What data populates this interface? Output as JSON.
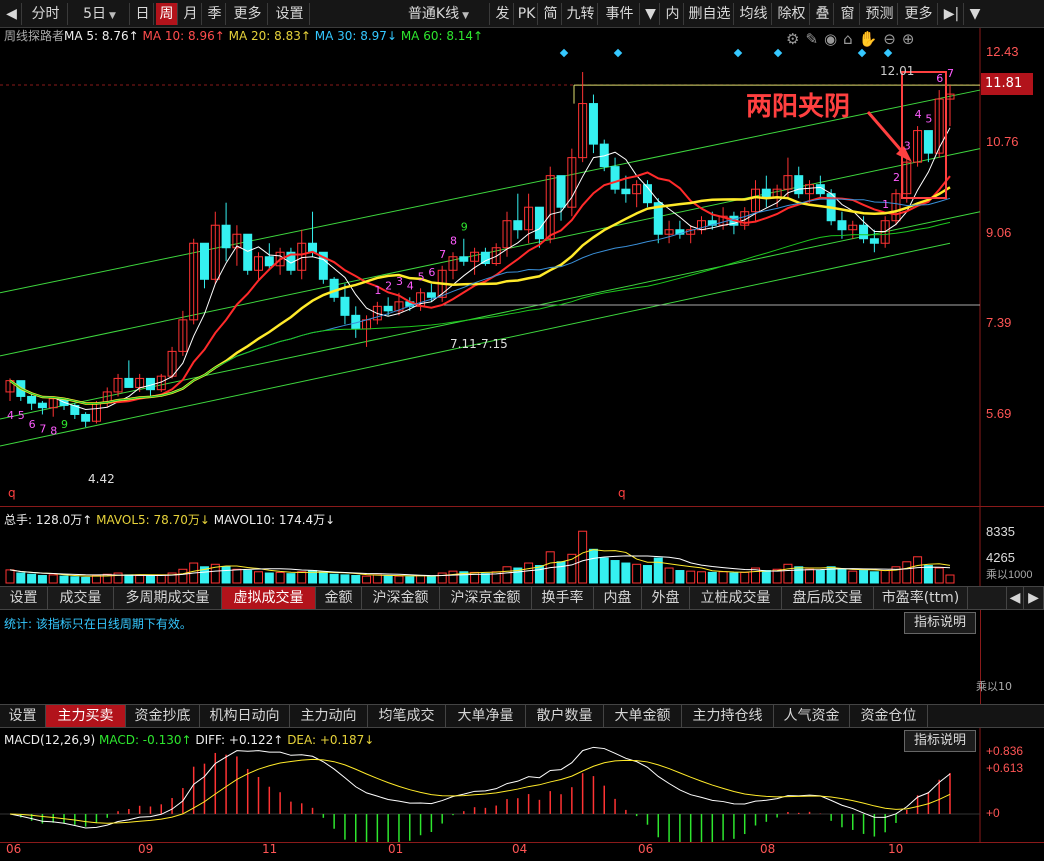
{
  "toolbar": {
    "items": [
      "分时",
      "5日",
      "日",
      "周",
      "月",
      "季",
      "更多",
      "设置",
      "普通K线",
      "发",
      "PK",
      "简",
      "九转",
      "事件",
      "内",
      "删自选",
      "均线",
      "除权",
      "叠",
      "窗",
      "预测",
      "更多"
    ],
    "active_period": "周"
  },
  "indicator_line": {
    "name": "周线探路者",
    "ma5": "MA 5:  8.76↑",
    "ma10": "MA 10:  8.96↑",
    "ma20": "MA 20:  8.83↑",
    "ma30": "MA 30:  8.97↓",
    "ma60": "MA 60:  8.14↑"
  },
  "price_axis": [
    "12.43",
    "10.76",
    "9.06",
    "7.39",
    "5.69"
  ],
  "current_price": "11.81",
  "chart_labels": {
    "high": "12.01",
    "low": "4.42",
    "level": "7.11-7.15",
    "annotation": "两阳夹阴",
    "q_marks": [
      "q",
      "q"
    ]
  },
  "nine_turn": {
    "first": [
      "4",
      "5",
      "6",
      "7",
      "8",
      "9"
    ],
    "second": [
      "1",
      "2",
      "3",
      "4",
      "5",
      "6",
      "7",
      "8",
      "9"
    ],
    "third": [
      "1",
      "2",
      "3",
      "4",
      "5",
      "6",
      "7"
    ]
  },
  "volume_panel": {
    "total": "总手: 128.0万↑",
    "mavol5": "MAVOL5: 78.70万↓",
    "mavol10": "MAVOL10: 174.4万↓",
    "axis": [
      "8335",
      "4265"
    ],
    "unit": "乘以1000"
  },
  "tabs1": [
    "设置",
    "成交量",
    "多周期成交量",
    "虚拟成交量",
    "金额",
    "沪深金额",
    "沪深京金额",
    "换手率",
    "内盘",
    "外盘",
    "立桩成交量",
    "盘后成交量",
    "市盈率(ttm)"
  ],
  "tabs1_active": "虚拟成交量",
  "stats_panel": {
    "text": "统计: 该指标只在日线周期下有效。",
    "button": "指标说明",
    "unit": "乘以10"
  },
  "tabs2": [
    "设置",
    "主力买卖",
    "资金抄底",
    "机构日动向",
    "主力动向",
    "均笔成交",
    "大单净量",
    "散户数量",
    "大单金额",
    "主力持仓线",
    "人气资金",
    "资金仓位"
  ],
  "tabs2_active": "主力买卖",
  "macd_panel": {
    "name": "MACD(12,26,9)",
    "macd": "MACD: -0.130↑",
    "diff": "DIFF: +0.122↑",
    "dea": "DEA: +0.187↓",
    "button": "指标说明",
    "axis": [
      "+0.836",
      "+0.613",
      "+0"
    ]
  },
  "x_axis": [
    "06",
    "09",
    "11",
    "01",
    "04",
    "06",
    "08",
    "10"
  ],
  "colors": {
    "up": "#ff3333",
    "down": "#35f0f0",
    "ma5": "#ffffff",
    "ma10": "#ff2a2a",
    "ma20": "#ffea2a",
    "ma30": "#3a8fd8",
    "ma60": "#1ec81e",
    "channel": "#3ed63e",
    "accent": "#b2131b"
  },
  "chart_data": {
    "type": "candlestick",
    "ylim": [
      4.0,
      12.9
    ],
    "candles": [
      [
        5.2,
        5.5,
        5.0,
        5.45
      ],
      [
        5.45,
        5.4,
        5.0,
        5.1
      ],
      [
        5.1,
        5.15,
        4.8,
        4.95
      ],
      [
        4.95,
        5.0,
        4.7,
        4.85
      ],
      [
        4.85,
        5.1,
        4.65,
        5.05
      ],
      [
        5.05,
        5.0,
        4.8,
        4.9
      ],
      [
        4.9,
        4.95,
        4.6,
        4.7
      ],
      [
        4.7,
        4.75,
        4.42,
        4.55
      ],
      [
        4.55,
        5.0,
        4.5,
        4.95
      ],
      [
        4.95,
        5.3,
        4.85,
        5.2
      ],
      [
        5.2,
        5.6,
        5.1,
        5.5
      ],
      [
        5.5,
        5.9,
        5.3,
        5.3
      ],
      [
        5.3,
        5.6,
        5.2,
        5.5
      ],
      [
        5.5,
        5.5,
        5.1,
        5.25
      ],
      [
        5.25,
        5.6,
        5.2,
        5.55
      ],
      [
        5.55,
        6.2,
        5.5,
        6.1
      ],
      [
        6.1,
        7.0,
        6.0,
        6.8
      ],
      [
        6.8,
        8.6,
        6.7,
        8.5
      ],
      [
        8.5,
        8.3,
        7.5,
        7.7
      ],
      [
        7.7,
        9.2,
        7.6,
        8.9
      ],
      [
        8.9,
        9.4,
        8.1,
        8.4
      ],
      [
        8.4,
        8.9,
        8.0,
        8.7
      ],
      [
        8.7,
        8.6,
        7.8,
        7.9
      ],
      [
        7.9,
        8.3,
        7.7,
        8.2
      ],
      [
        8.2,
        8.5,
        7.9,
        8.0
      ],
      [
        8.0,
        8.4,
        7.8,
        8.3
      ],
      [
        8.3,
        8.4,
        7.8,
        7.9
      ],
      [
        7.9,
        8.8,
        7.7,
        8.5
      ],
      [
        8.5,
        9.2,
        8.2,
        8.3
      ],
      [
        8.3,
        8.2,
        7.6,
        7.7
      ],
      [
        7.7,
        7.75,
        7.2,
        7.3
      ],
      [
        7.3,
        7.6,
        6.7,
        6.9
      ],
      [
        6.9,
        7.1,
        6.4,
        6.6
      ],
      [
        6.6,
        6.9,
        6.2,
        6.8
      ],
      [
        6.8,
        7.2,
        6.7,
        7.1
      ],
      [
        7.1,
        7.3,
        6.9,
        7.0
      ],
      [
        7.0,
        7.4,
        6.9,
        7.2
      ],
      [
        7.2,
        7.3,
        7.0,
        7.1
      ],
      [
        7.1,
        7.5,
        7.0,
        7.4
      ],
      [
        7.4,
        7.6,
        7.2,
        7.3
      ],
      [
        7.3,
        8.0,
        7.2,
        7.9
      ],
      [
        7.9,
        8.3,
        7.7,
        8.2
      ],
      [
        8.2,
        8.6,
        8.0,
        8.1
      ],
      [
        8.1,
        8.4,
        7.8,
        8.3
      ],
      [
        8.3,
        8.4,
        8.0,
        8.05
      ],
      [
        8.05,
        8.5,
        8.0,
        8.4
      ],
      [
        8.4,
        9.2,
        8.2,
        9.0
      ],
      [
        9.0,
        9.6,
        8.6,
        8.8
      ],
      [
        8.8,
        9.6,
        8.5,
        9.3
      ],
      [
        9.3,
        9.1,
        8.4,
        8.6
      ],
      [
        8.6,
        10.2,
        8.5,
        10.0
      ],
      [
        10.0,
        9.8,
        9.0,
        9.3
      ],
      [
        9.3,
        10.6,
        9.1,
        10.4
      ],
      [
        10.4,
        12.3,
        10.3,
        11.6
      ],
      [
        11.6,
        11.8,
        10.5,
        10.7
      ],
      [
        10.7,
        10.8,
        10.1,
        10.2
      ],
      [
        10.2,
        10.4,
        9.6,
        9.7
      ],
      [
        9.7,
        10.0,
        9.4,
        9.6
      ],
      [
        9.6,
        9.9,
        9.3,
        9.8
      ],
      [
        9.8,
        9.9,
        9.3,
        9.4
      ],
      [
        9.4,
        9.5,
        8.5,
        8.7
      ],
      [
        8.7,
        9.0,
        8.5,
        8.8
      ],
      [
        8.8,
        9.0,
        8.6,
        8.7
      ],
      [
        8.7,
        8.9,
        8.5,
        8.8
      ],
      [
        8.8,
        9.1,
        8.7,
        9.0
      ],
      [
        9.0,
        9.2,
        8.8,
        8.9
      ],
      [
        8.9,
        9.3,
        8.8,
        9.1
      ],
      [
        9.1,
        9.2,
        8.7,
        8.9
      ],
      [
        8.9,
        9.3,
        8.8,
        9.2
      ],
      [
        9.2,
        9.9,
        9.0,
        9.7
      ],
      [
        9.7,
        10.0,
        9.3,
        9.5
      ],
      [
        9.5,
        9.8,
        9.3,
        9.7
      ],
      [
        9.7,
        10.4,
        9.5,
        10.0
      ],
      [
        10.0,
        10.2,
        9.5,
        9.6
      ],
      [
        9.6,
        9.9,
        9.4,
        9.8
      ],
      [
        9.8,
        10.0,
        9.5,
        9.6
      ],
      [
        9.6,
        9.7,
        8.9,
        9.0
      ],
      [
        9.0,
        9.2,
        8.6,
        8.8
      ],
      [
        8.8,
        9.0,
        8.6,
        8.9
      ],
      [
        8.9,
        9.1,
        8.5,
        8.6
      ],
      [
        8.6,
        8.8,
        8.3,
        8.5
      ],
      [
        8.5,
        9.1,
        8.4,
        9.0
      ],
      [
        9.0,
        9.7,
        8.9,
        9.6
      ],
      [
        9.6,
        10.4,
        9.4,
        10.3
      ],
      [
        10.3,
        11.1,
        10.2,
        11.0
      ],
      [
        11.0,
        11.0,
        10.3,
        10.5
      ],
      [
        10.5,
        11.9,
        10.4,
        11.7
      ],
      [
        11.7,
        12.01,
        11.1,
        11.81
      ]
    ],
    "volume": [
      2.1,
      1.6,
      1.4,
      1.2,
      1.3,
      1.1,
      1.0,
      0.9,
      1.2,
      1.4,
      1.6,
      1.3,
      1.2,
      1.1,
      1.3,
      1.6,
      2.2,
      3.2,
      2.6,
      3.0,
      2.6,
      2.2,
      2.0,
      1.8,
      1.6,
      1.7,
      1.5,
      1.8,
      2.0,
      1.7,
      1.4,
      1.3,
      1.2,
      1.1,
      1.3,
      1.2,
      1.1,
      1.0,
      1.2,
      1.1,
      1.6,
      1.9,
      1.8,
      1.7,
      1.5,
      1.8,
      2.6,
      2.4,
      3.2,
      2.8,
      5.0,
      3.4,
      4.6,
      8.3,
      5.4,
      4.0,
      3.6,
      3.2,
      3.0,
      2.8,
      4.0,
      2.4,
      2.0,
      1.9,
      1.8,
      1.7,
      1.8,
      1.6,
      1.7,
      2.4,
      2.0,
      2.2,
      3.0,
      2.6,
      2.2,
      2.0,
      2.6,
      2.2,
      1.9,
      2.0,
      1.8,
      2.0,
      2.6,
      3.4,
      4.2,
      2.8,
      2.4,
      1.28
    ]
  }
}
